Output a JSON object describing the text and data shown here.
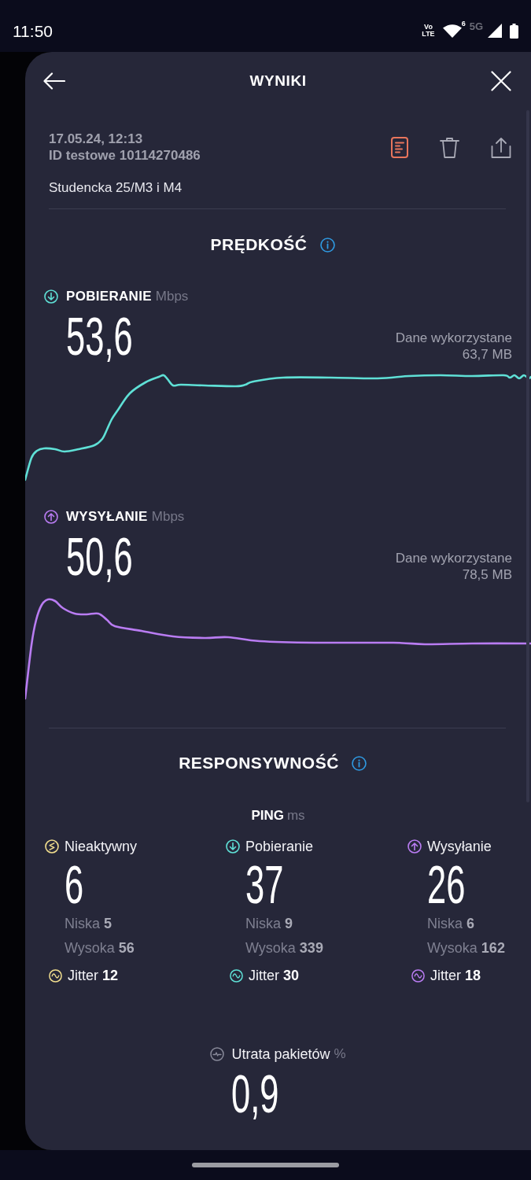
{
  "status_bar": {
    "time": "11:50",
    "volte_top": "Vo",
    "volte_bottom": "LTE",
    "wifi_badge": "6",
    "network": "5G"
  },
  "header": {
    "title": "WYNIKI"
  },
  "test": {
    "date": "17.05.24, 12:13",
    "test_id": "ID testowe 10114270486",
    "location": "Studencka 25/M3 i M4"
  },
  "speed": {
    "title": "PRĘDKOŚĆ",
    "metrics": [
      {
        "kind": "download",
        "label": "POBIERANIE",
        "unit": "Mbps",
        "value": "53,6",
        "data_label": "Dane wykorzystane",
        "data_value": "63,7 MB",
        "color": "#5fe0d6"
      },
      {
        "kind": "upload",
        "label": "WYSYŁANIE",
        "unit": "Mbps",
        "value": "50,6",
        "data_label": "Dane wykorzystane",
        "data_value": "78,5 MB",
        "color": "#b97cf2"
      }
    ]
  },
  "responsiveness": {
    "title": "RESPONSYWNOŚĆ",
    "ping_label": "PING",
    "ping_unit": "ms",
    "columns": [
      {
        "kind": "idle",
        "label": "Nieaktywny",
        "value": "6",
        "low": "Niska **5**",
        "high": "Wysoka **56**",
        "jitter": "Jitter **12**",
        "color": "#f1de8e"
      },
      {
        "kind": "download",
        "label": "Pobieranie",
        "value": "37",
        "low": "Niska **9**",
        "high": "Wysoka **339**",
        "jitter": "Jitter **30**",
        "color": "#5fe0d6"
      },
      {
        "kind": "upload",
        "label": "Wysyłanie",
        "value": "26",
        "low": "Niska **6**",
        "high": "Wysoka **162**",
        "jitter": "Jitter **18**",
        "color": "#b97cf2"
      }
    ]
  },
  "packet_loss": {
    "label": "Utrata pakietów",
    "unit": "%",
    "value": "0,9"
  }
}
